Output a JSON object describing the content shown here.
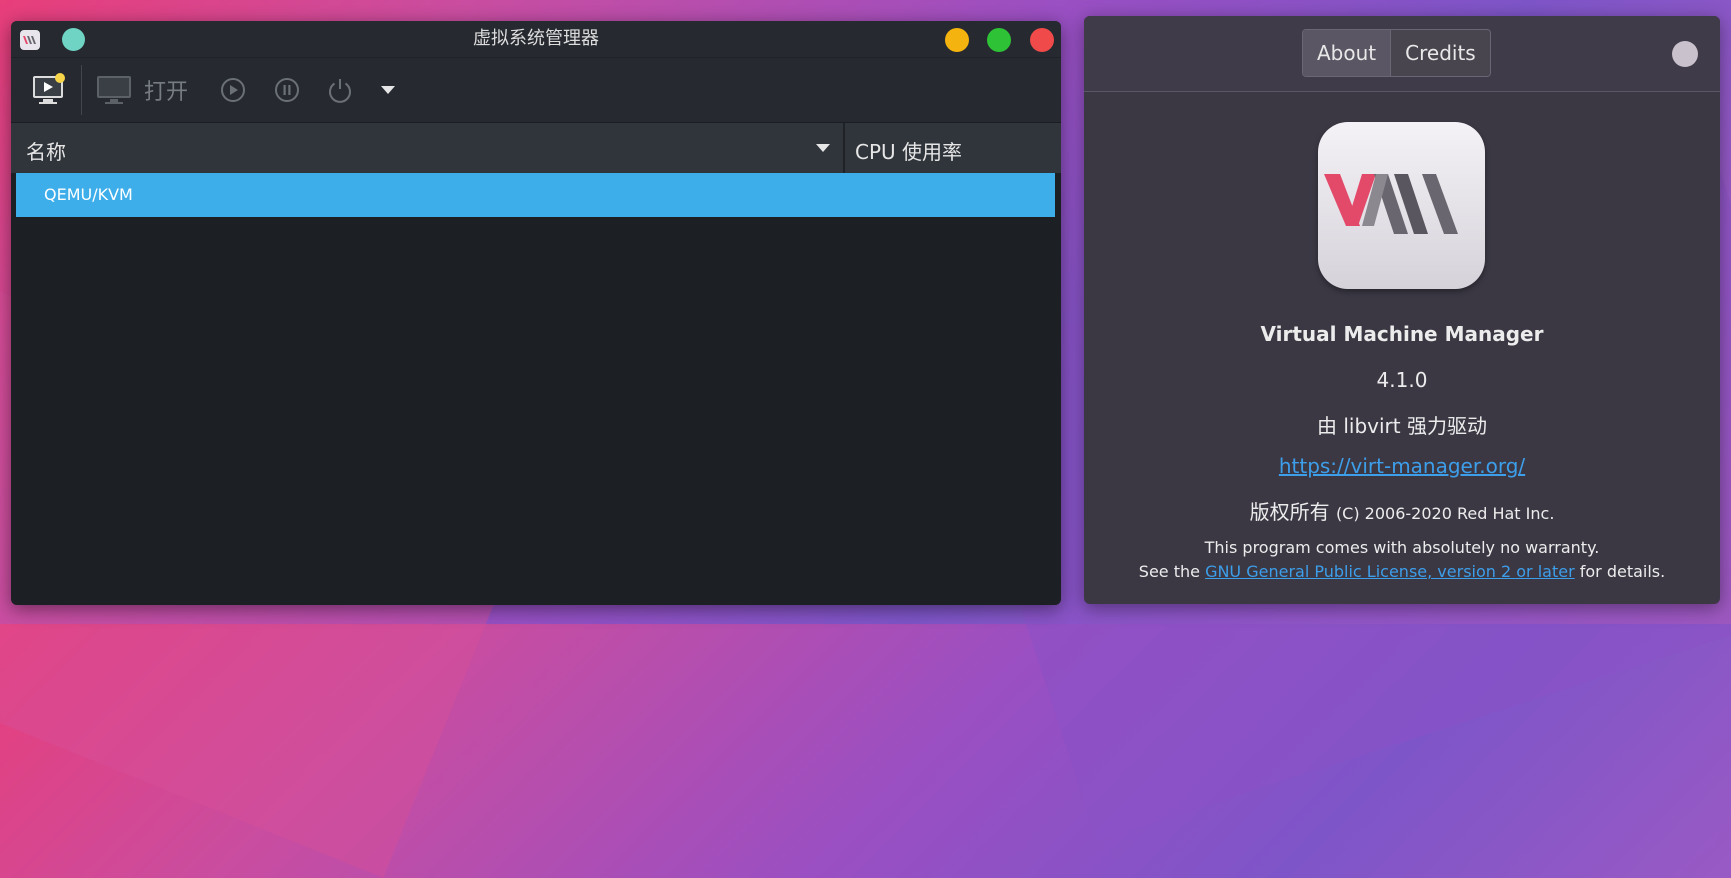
{
  "colors": {
    "selection": "#3daee9",
    "link": "#3d9eea",
    "minimize": "#f4b30e",
    "maximize": "#2ec236",
    "close": "#f04a4a"
  },
  "main_window": {
    "title": "虚拟系统管理器",
    "toolbar": {
      "new_vm_icon": "new-vm-icon",
      "open_label": "打开",
      "run_icon": "play-icon",
      "pause_icon": "pause-icon",
      "shutdown_icon": "power-icon",
      "menu_icon": "chevron-down-icon"
    },
    "table": {
      "columns": [
        "名称",
        "CPU 使用率"
      ],
      "rows": [
        {
          "name": "QEMU/KVM",
          "selected": true
        }
      ]
    }
  },
  "about_window": {
    "tabs": [
      "About",
      "Credits"
    ],
    "active_tab": "About",
    "app_name": "Virtual Machine Manager",
    "version": "4.1.0",
    "powered_by": "由 libvirt 强力驱动",
    "website": "https://virt-manager.org/",
    "copyright_prefix": "版权所有",
    "copyright_rest": "(C) 2006-2020 Red Hat Inc.",
    "warranty_line": "This program comes with absolutely no warranty.",
    "license_prefix": "See the ",
    "license_link": "GNU General Public License, version 2 or later",
    "license_suffix": " for details.",
    "logo": {
      "text": "VM"
    }
  }
}
